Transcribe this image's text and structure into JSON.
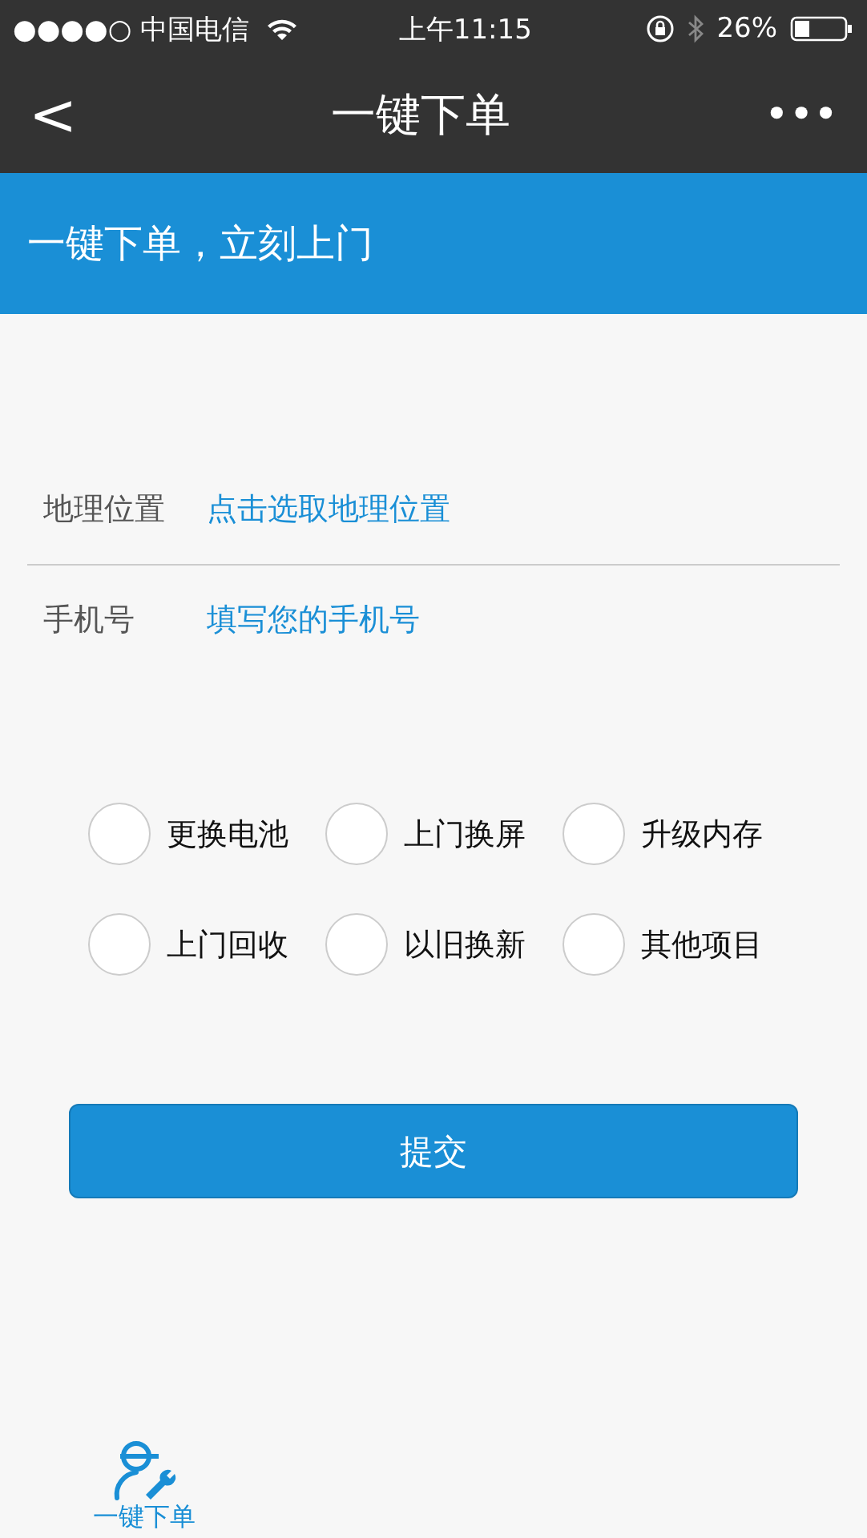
{
  "status_bar": {
    "carrier": "●●●●○ 中国电信",
    "time": "上午11:15",
    "battery": "26%"
  },
  "nav_bar": {
    "back": "<",
    "title": "一键下单",
    "more": "•••"
  },
  "banner": {
    "text": "一键下单，立刻上门"
  },
  "form": [
    {
      "label": "地理位置",
      "placeholder": "点击选取地理位置"
    },
    {
      "label": "手机号",
      "placeholder": "填写您的手机号"
    }
  ],
  "services": [
    {
      "label": "更换电池",
      "checked": false
    },
    {
      "label": "上门换屏",
      "checked": false
    },
    {
      "label": "升级内存",
      "checked": false
    },
    {
      "label": "上门回收",
      "checked": false
    },
    {
      "label": "以旧换新",
      "checked": false
    },
    {
      "label": "其他项目",
      "checked": false
    }
  ],
  "submit": "提交",
  "tab_bar": [
    {
      "label": "一键下单",
      "selected": true
    }
  ]
}
